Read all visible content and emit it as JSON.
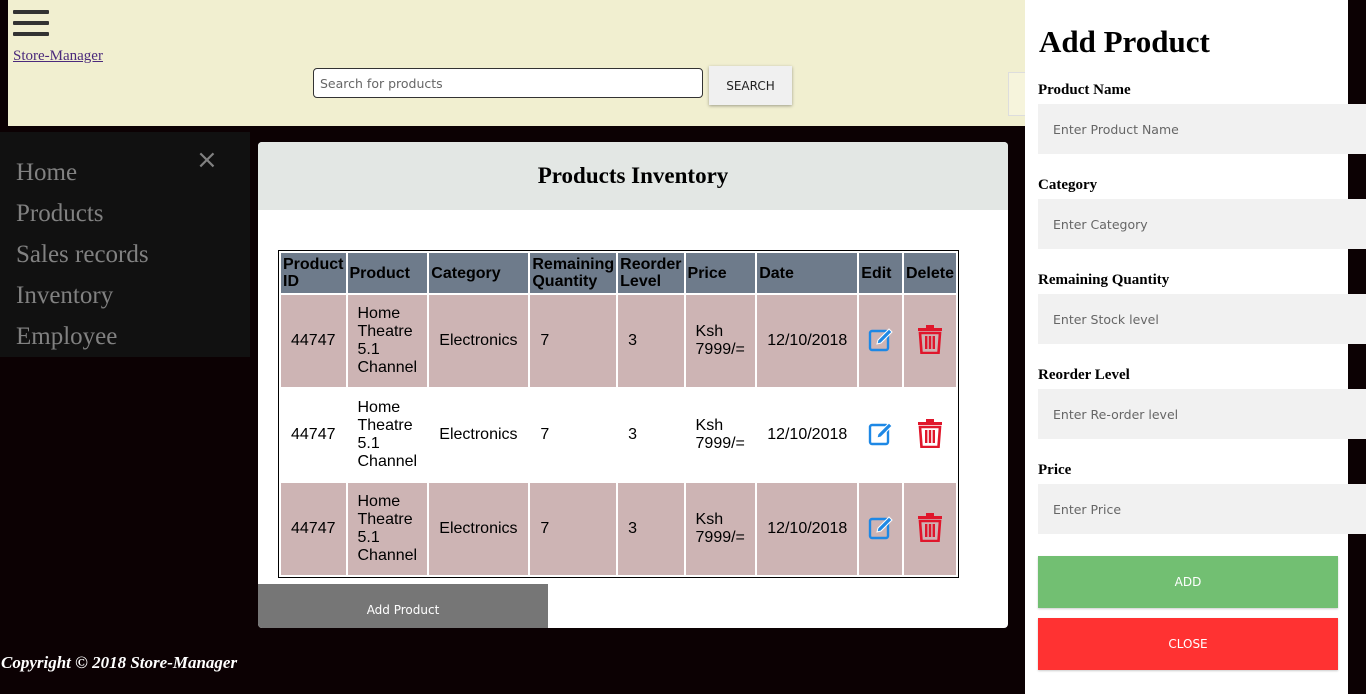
{
  "header": {
    "brand": "Store-Manager",
    "search_placeholder": "Search for products",
    "search_label": "SEARCH"
  },
  "sidebar": {
    "close_icon": "×",
    "items": [
      "Home",
      "Products",
      "Sales records",
      "Inventory",
      "Employee"
    ]
  },
  "inventory": {
    "title": "Products Inventory",
    "columns": [
      "Product ID",
      "Product",
      "Category",
      "Remaining Quantity",
      "Reorder Level",
      "Price",
      "Date",
      "Edit",
      "Delete"
    ],
    "rows": [
      {
        "id": "44747",
        "product": "Home Theatre 5.1 Channel",
        "category": "Electronics",
        "qty": "7",
        "reorder": "3",
        "price": "Ksh 7999/=",
        "date": "12/10/2018"
      },
      {
        "id": "44747",
        "product": "Home Theatre 5.1 Channel",
        "category": "Electronics",
        "qty": "7",
        "reorder": "3",
        "price": "Ksh 7999/=",
        "date": "12/10/2018"
      },
      {
        "id": "44747",
        "product": "Home Theatre 5.1 Channel",
        "category": "Electronics",
        "qty": "7",
        "reorder": "3",
        "price": "Ksh 7999/=",
        "date": "12/10/2018"
      }
    ],
    "add_label": "Add Product",
    "icons": {
      "edit": "edit-icon",
      "delete": "trash-icon"
    },
    "colors": {
      "edit": "#1e88e5",
      "delete": "#e0162b"
    }
  },
  "footer": {
    "copyright": "Copyright © 2018 Store-Manager"
  },
  "form": {
    "title": "Add Product",
    "fields": [
      {
        "label": "Product Name",
        "placeholder": "Enter Product Name"
      },
      {
        "label": "Category",
        "placeholder": "Enter Category"
      },
      {
        "label": "Remaining Quantity",
        "placeholder": "Enter Stock level"
      },
      {
        "label": "Reorder Level",
        "placeholder": "Enter Re-order level"
      },
      {
        "label": "Price",
        "placeholder": "Enter Price"
      }
    ],
    "add_label": "ADD",
    "close_label": "CLOSE"
  }
}
